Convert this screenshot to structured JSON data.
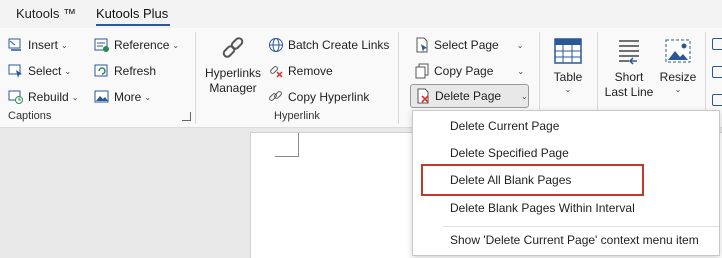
{
  "tabs": [
    {
      "label": "Kutools ™"
    },
    {
      "label": "Kutools Plus"
    }
  ],
  "colors": {
    "accent": "#2b5797",
    "highlight_border": "#c0392b",
    "delete_icon": "#d9302c"
  },
  "captions": {
    "insert": "Insert",
    "select": "Select",
    "rebuild": "Rebuild",
    "reference": "Reference",
    "refresh": "Refresh",
    "more": "More",
    "group_label": "Captions"
  },
  "hyperlink": {
    "manager_line1": "Hyperlinks",
    "manager_line2": "Manager",
    "batch_create": "Batch Create Links",
    "remove": "Remove",
    "copy": "Copy Hyperlink",
    "group_label": "Hyperlink"
  },
  "pages": {
    "select_page": "Select Page",
    "copy_page": "Copy Page",
    "delete_page": "Delete Page"
  },
  "table": {
    "label": "Table"
  },
  "short_last_line": {
    "line1": "Short",
    "line2": "Last Line"
  },
  "resize": {
    "label": "Resize"
  },
  "menu": {
    "items": [
      {
        "label": "Delete Current Page"
      },
      {
        "label": "Delete Specified Page"
      },
      {
        "label": "Delete All Blank Pages"
      },
      {
        "label": "Delete Blank Pages Within Interval"
      },
      {
        "label": "Show 'Delete Current Page' context menu item"
      }
    ]
  }
}
